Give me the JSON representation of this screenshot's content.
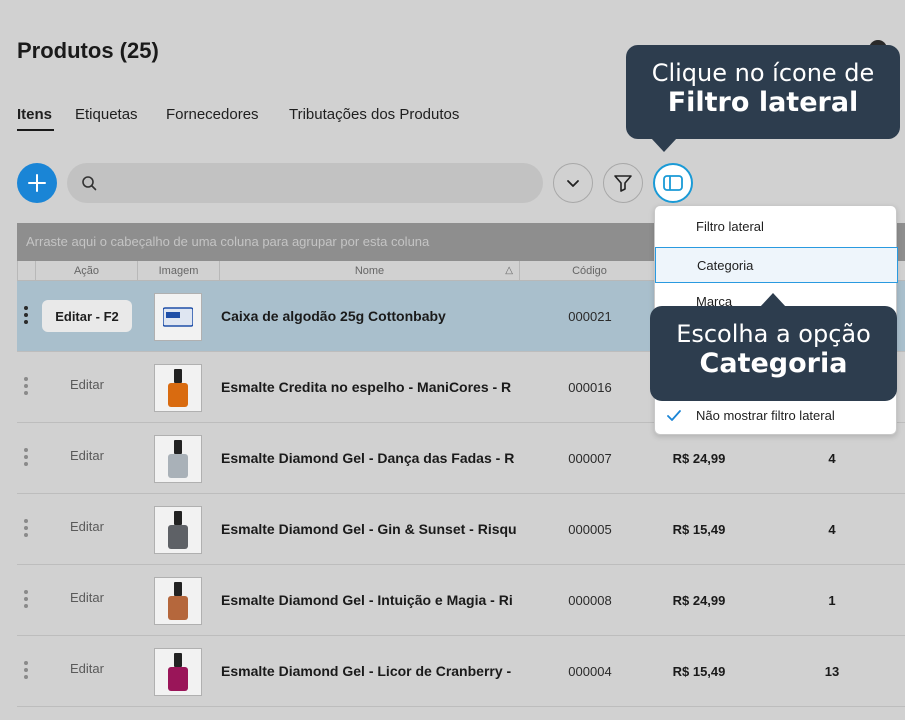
{
  "page": {
    "title": "Produtos (25)"
  },
  "tabs": [
    {
      "label": "Itens",
      "active": true
    },
    {
      "label": "Etiquetas",
      "active": false
    },
    {
      "label": "Fornecedores",
      "active": false
    },
    {
      "label": "Tributações dos Produtos",
      "active": false
    }
  ],
  "grid": {
    "group_hint": "Arraste aqui o cabeçalho de uma coluna para agrupar por esta coluna",
    "columns": {
      "acao": "Ação",
      "imagem": "Imagem",
      "nome": "Nome",
      "codigo": "Código"
    },
    "sort_indicator": "△",
    "rows": [
      {
        "action": "Editar - F2",
        "name": "Caixa de algodão 25g Cottonbaby",
        "code": "000021",
        "price": "",
        "qty": "",
        "selected": true,
        "bottle_color": "#1f4fa8"
      },
      {
        "action": "Editar",
        "name": "Esmalte Credita no espelho - ManiCores - R",
        "code": "000016",
        "price": "",
        "qty": "",
        "selected": false,
        "bottle_color": "#d96b10"
      },
      {
        "action": "Editar",
        "name": "Esmalte Diamond Gel - Dança das Fadas - R",
        "code": "000007",
        "price": "R$ 24,99",
        "qty": "4",
        "selected": false,
        "bottle_color": "#a9b1b8"
      },
      {
        "action": "Editar",
        "name": "Esmalte Diamond Gel - Gin & Sunset - Risqu",
        "code": "000005",
        "price": "R$ 15,49",
        "qty": "4",
        "selected": false,
        "bottle_color": "#5e6166"
      },
      {
        "action": "Editar",
        "name": "Esmalte Diamond Gel - Intuição e Magia - Ri",
        "code": "000008",
        "price": "R$ 24,99",
        "qty": "1",
        "selected": false,
        "bottle_color": "#b5673c"
      },
      {
        "action": "Editar",
        "name": "Esmalte Diamond Gel - Licor de Cranberry -",
        "code": "000004",
        "price": "R$ 15,49",
        "qty": "13",
        "selected": false,
        "bottle_color": "#9a1559"
      }
    ]
  },
  "dropdown": {
    "items": [
      {
        "label": "Filtro lateral"
      },
      {
        "label": "Categoria"
      },
      {
        "label": "Marca"
      },
      {
        "label": "Não mostrar filtro lateral"
      }
    ]
  },
  "callouts": {
    "top": {
      "line1": "Clique no ícone de",
      "line2": "Filtro lateral"
    },
    "bottom": {
      "line1": "Escolha a opção",
      "line2": "Categoria"
    }
  },
  "colors": {
    "accent": "#1a85d6",
    "callout_bg": "#2d3d4e",
    "selected_row": "#a9bfcc"
  }
}
